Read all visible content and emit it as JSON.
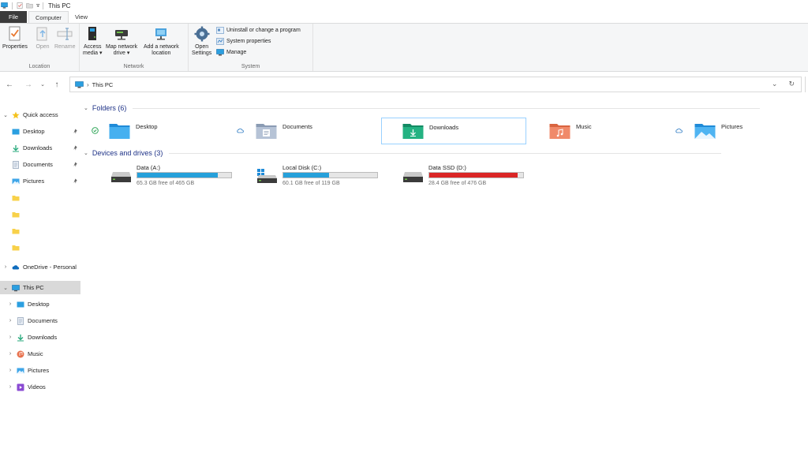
{
  "window": {
    "title": "This PC"
  },
  "quick_access_toolbar": {
    "icons": [
      "computer-icon",
      "properties-icon",
      "new-folder-icon",
      "customize-dropdown-icon"
    ]
  },
  "ribbon_tabs": [
    {
      "label": "File"
    },
    {
      "label": "Computer"
    },
    {
      "label": "View"
    }
  ],
  "ribbon": {
    "location": {
      "label": "Location",
      "properties": "Properties",
      "open": "Open",
      "rename": "Rename"
    },
    "network": {
      "label": "Network",
      "access_media_1": "Access",
      "access_media_2": "media ▾",
      "map_drive_1": "Map network",
      "map_drive_2": "drive ▾",
      "add_location_1": "Add a network",
      "add_location_2": "location"
    },
    "system": {
      "label": "System",
      "open_settings_1": "Open",
      "open_settings_2": "Settings",
      "uninstall": "Uninstall or change a program",
      "system_properties": "System properties",
      "manage": "Manage"
    }
  },
  "address_bar": {
    "crumb": "This PC",
    "separator": "›"
  },
  "sidebar": {
    "quick_access": "Quick access",
    "pinned": [
      {
        "label": "Desktop"
      },
      {
        "label": "Downloads"
      },
      {
        "label": "Documents"
      },
      {
        "label": "Pictures"
      }
    ],
    "onedrive": "OneDrive - Personal",
    "this_pc": "This PC",
    "this_pc_children": [
      {
        "label": "Desktop"
      },
      {
        "label": "Documents"
      },
      {
        "label": "Downloads"
      },
      {
        "label": "Music"
      },
      {
        "label": "Pictures"
      },
      {
        "label": "Videos"
      }
    ]
  },
  "folders_section": {
    "header": "Folders (6)",
    "items": [
      {
        "name": "Desktop",
        "status": "synced"
      },
      {
        "name": "Documents",
        "status": "cloud"
      },
      {
        "name": "Downloads",
        "status": ""
      },
      {
        "name": "Music",
        "status": ""
      },
      {
        "name": "Pictures",
        "status": "cloud"
      }
    ]
  },
  "drives_section": {
    "header": "Devices and drives (3)",
    "items": [
      {
        "name": "Data (A:)",
        "free_text": "65.3 GB free of 465 GB",
        "used_fraction": 0.86,
        "bar_color": "#26a0da"
      },
      {
        "name": "Local Disk (C:)",
        "free_text": "60.1 GB free of 119 GB",
        "used_fraction": 0.49,
        "bar_color": "#26a0da"
      },
      {
        "name": "Data SSD (D:)",
        "free_text": "28.4 GB free of 476 GB",
        "used_fraction": 0.94,
        "bar_color": "#da2626"
      }
    ]
  },
  "colors": {
    "accent": "#0078d4",
    "section_header": "#1e3287",
    "selected_row": "#d9d9d9",
    "hover_border": "#99d1ff"
  }
}
